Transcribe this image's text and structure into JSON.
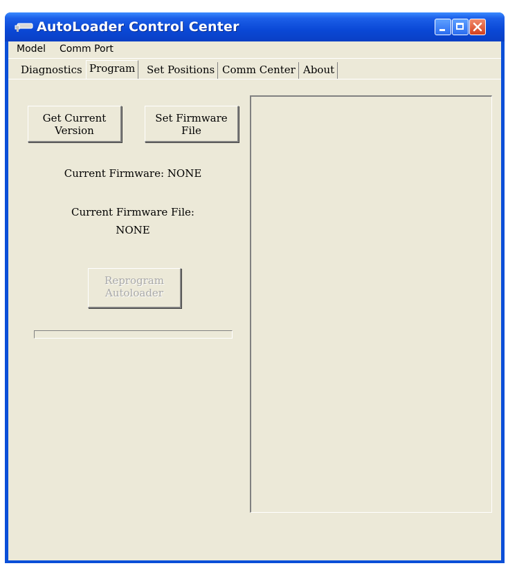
{
  "window": {
    "title": "AutoLoader Control Center",
    "controls": {
      "minimize_icon": "minimize-icon",
      "maximize_icon": "maximize-icon",
      "close_icon": "close-icon"
    },
    "colors": {
      "titlebar": "#0a48d6",
      "client": "#ece9d8",
      "close_button": "#d4401e"
    }
  },
  "menu": {
    "items": [
      "Model",
      "Comm Port"
    ]
  },
  "tabs": [
    {
      "label": "Diagnostics",
      "selected": false
    },
    {
      "label": "Program",
      "selected": true
    },
    {
      "label": "Set Positions",
      "selected": false
    },
    {
      "label": "Comm Center",
      "selected": false
    },
    {
      "label": "About",
      "selected": false
    }
  ],
  "program": {
    "get_version_button": {
      "line1": "Get Current",
      "line2": "Version"
    },
    "set_firmware_button": {
      "line1": "Set Firmware",
      "line2": "File"
    },
    "current_firmware_label": "Current Firmware: NONE",
    "current_firmware_file_label": "Current Firmware File:",
    "current_firmware_file_value": "NONE",
    "reprogram_button": {
      "line1": "Reprogram",
      "line2": "Autoloader",
      "enabled": false
    },
    "progress": 0
  },
  "output_box": {
    "text": ""
  }
}
